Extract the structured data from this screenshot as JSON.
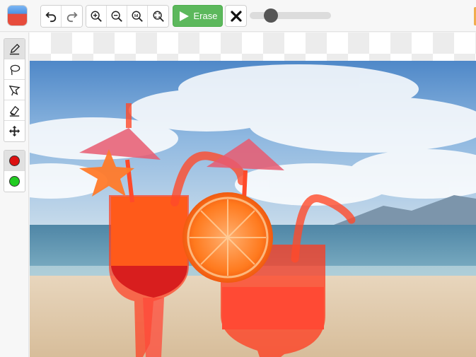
{
  "toolbar": {
    "erase_label": "Erase",
    "brush_size_percent": 26,
    "buttons": {
      "undo": "undo-icon",
      "redo": "redo-icon",
      "zoom_in": "zoom-in-icon",
      "zoom_out": "zoom-out-icon",
      "zoom_actual": "zoom-actual-size-icon",
      "zoom_fit": "zoom-fit-icon",
      "play": "play-icon",
      "clear": "close-icon"
    }
  },
  "tools": {
    "items": [
      "pencil-icon",
      "lasso-icon",
      "polygon-lasso-icon",
      "eraser-icon",
      "move-icon"
    ],
    "active": "pencil-icon"
  },
  "colors": {
    "foreground_swatch": "#dd1111",
    "background_swatch": "#22cc22",
    "erase_button": "#5cb85c",
    "mask_overlay": "#ff3a1e"
  }
}
